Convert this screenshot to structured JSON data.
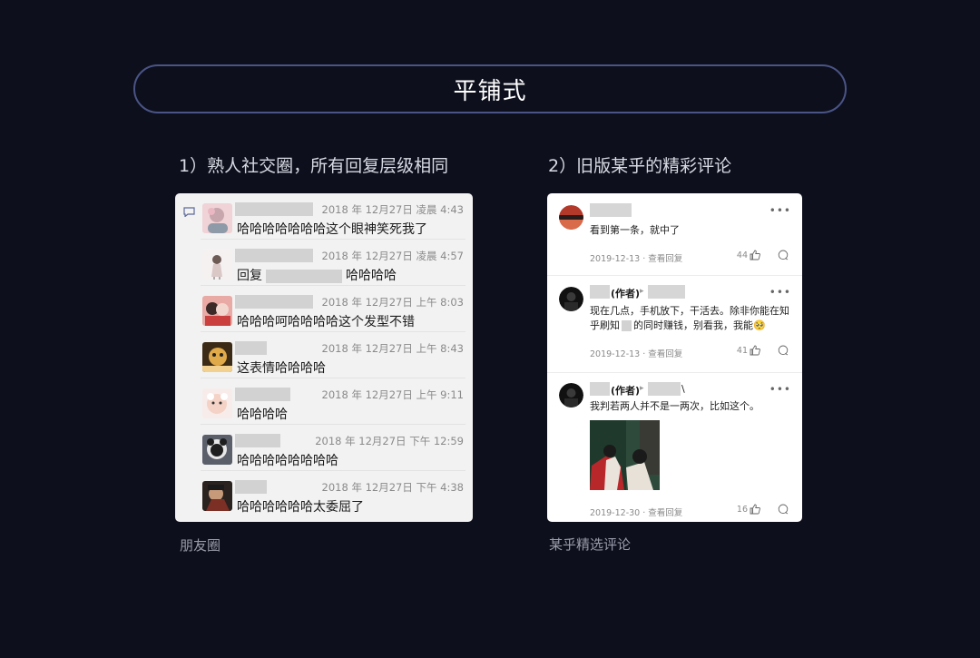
{
  "title": "平铺式",
  "left": {
    "heading": "1）熟人社交圈，所有回复层级相同",
    "caption": "朋友圈",
    "rows": [
      {
        "time": "2018 年 12月27日 凌晨 4:43",
        "text": "哈哈哈哈哈哈哈这个眼神笑死我了"
      },
      {
        "time": "2018 年 12月27日 凌晨 4:57",
        "reply_prefix": "回复",
        "reply_suffix": "哈哈哈哈"
      },
      {
        "time": "2018 年 12月27日 上午 8:03",
        "text": "哈哈哈呵哈哈哈哈这个发型不错"
      },
      {
        "time": "2018 年 12月27日 上午 8:43",
        "text": "这表情哈哈哈哈"
      },
      {
        "time": "2018 年 12月27日 上午 9:11",
        "text": "哈哈哈哈"
      },
      {
        "time": "2018 年 12月27日 下午 12:59",
        "text": "哈哈哈哈哈哈哈哈"
      },
      {
        "time": "2018 年 12月27日 下午 4:38",
        "text": "哈哈哈哈哈哈太委屈了"
      }
    ]
  },
  "right": {
    "heading": "2）旧版某乎的精彩评论",
    "caption": "某乎精选评论",
    "comments": [
      {
        "text": "看到第一条，就中了",
        "date": "2019-12-13",
        "view": "查看回复",
        "likes": "44"
      },
      {
        "author": "(作者)",
        "text_line1": "现在几点，手机放下，干活去。除非你能在知",
        "text_line2a": "乎刷知",
        "text_line2b": "的同时赚钱，别看我，我能🥺",
        "date": "2019-12-13",
        "view": "查看回复",
        "likes": "41"
      },
      {
        "author": "(作者)",
        "author_tail": "\\",
        "text": "我判若两人并不是一两次，比如这个。",
        "date": "2019-12-30",
        "view": "查看回复",
        "likes": "16"
      }
    ]
  },
  "colors": {
    "background": "#0d0f1c",
    "pill_border": "#4a5486",
    "card_left": "#f2f2f2",
    "card_right": "#ffffff"
  }
}
